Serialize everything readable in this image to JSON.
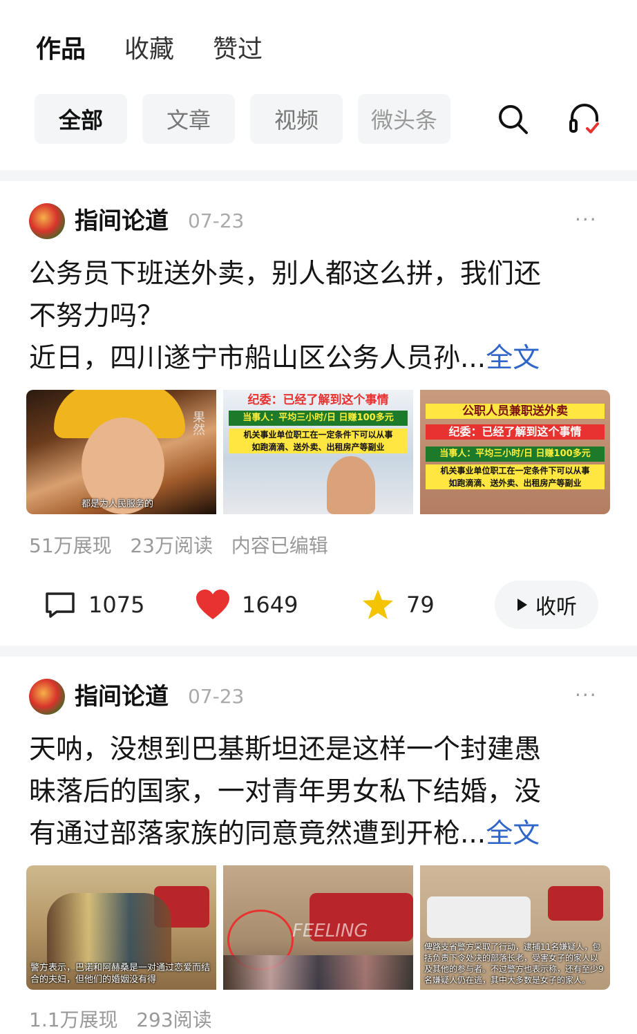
{
  "tabs": [
    "作品",
    "收藏",
    "赞过"
  ],
  "filters": [
    "全部",
    "文章",
    "视频",
    "微头条"
  ],
  "colors": {
    "link": "#2f66c7",
    "like": "#e8322f",
    "star": "#f5c400"
  },
  "icons": {
    "search": "search-icon",
    "listen": "headphones-icon"
  },
  "posts": [
    {
      "author": "指间论道",
      "date": "07-23",
      "more": "···",
      "title_lines": [
        "公务员下班送外卖，别人都这么拼，我们还",
        "不努力吗？"
      ],
      "body_line": "近日，四川遂宁市船山区公务人员孙...",
      "full_label": "全文",
      "images": [
        {
          "caption": "都是为人民服务的",
          "watermark": "果然"
        },
        {
          "line1": "纪委：已经了解到这个事情",
          "line2": "当事人：平均三小时/日 日赚100多元",
          "line3": "机关事业单位职工在一定条件下可以从事",
          "line4": "如跑滴滴、送外卖、出租房产等副业"
        },
        {
          "line0": "公职人员兼职送外卖",
          "line1": "纪委：已经了解到这个事情",
          "line2": "当事人：平均三小时/日 日赚100多元",
          "line3": "机关事业单位职工在一定条件下可以从事",
          "line4": "如跑滴滴、送外卖、出租房产等副业"
        }
      ],
      "stats": [
        "51万展现",
        "23万阅读",
        "内容已编辑"
      ],
      "comments": "1075",
      "likes": "1649",
      "favorites": "79",
      "listen_label": "收听"
    },
    {
      "author": "指间论道",
      "date": "07-23",
      "more": "···",
      "body_lines": [
        "天呐，没想到巴基斯坦还是这样一个封建愚",
        "昧落后的国家，一对青年男女私下结婚，没",
        "有通过部落家族的同意竟然遭到开枪..."
      ],
      "full_label": "全文",
      "images": [
        {
          "caption": "警方表示，巴诺和阿赫桑是一对通过恋爱而结合的夫妇，但他们的婚姻没有得"
        },
        {
          "watermark": "FEELING"
        },
        {
          "caption": "俾路支省警方采取了行动，逮捕11名嫌疑人，包括负责下令处决的部落长老，受害女子的家人以及其他的参与者。不过警方也表示称，还有至少9名嫌疑人仍在逃，其中大多数是女子的家人。"
        }
      ],
      "stats": [
        "1.1万展现",
        "293阅读"
      ]
    }
  ]
}
